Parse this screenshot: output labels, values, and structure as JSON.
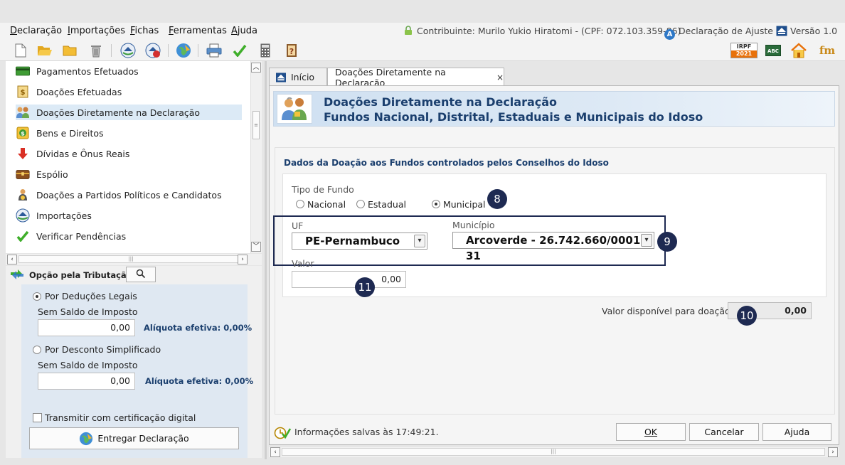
{
  "menu": [
    "Declaração",
    "Importações",
    "Fichas",
    "Ferramentas",
    "Ajuda"
  ],
  "header_info": {
    "taxpayer": "Contribuinte: Murilo Yukio Hiratomi - (CPF: 072.103.359-86)",
    "declaration_type": "Declaração de Ajuste",
    "version": "Versão 1.0"
  },
  "toolbar": {
    "icons": [
      "new-file-icon",
      "open-folder-icon",
      "folder-icon",
      "trash-icon",
      "receita-icon",
      "receita-refresh-icon",
      "globe-icon",
      "print-icon",
      "check-icon",
      "calculator-icon",
      "help-book-icon"
    ],
    "right_icons": [
      "irpf-2021-icon",
      "abc-icon",
      "home-icon",
      "fm-icon"
    ],
    "irpf_badge_top": "IRPF",
    "irpf_badge_year": "2021",
    "abc_badge": "ABC",
    "fm_badge": "fm"
  },
  "sidebar": {
    "items": [
      {
        "label": "Pagamentos Efetuados",
        "icon": "card-icon",
        "selected": false
      },
      {
        "label": "Doações Efetuadas",
        "icon": "doc-money-icon",
        "selected": false
      },
      {
        "label": "Doações Diretamente na Declaração",
        "icon": "people-icon",
        "selected": true
      },
      {
        "label": "Bens e Direitos",
        "icon": "money-bag-icon",
        "selected": false
      },
      {
        "label": "Dívidas e Ônus Reais",
        "icon": "down-arrow-icon",
        "selected": false
      },
      {
        "label": "Espólio",
        "icon": "chest-icon",
        "selected": false
      },
      {
        "label": "Doações a Partidos Políticos e Candidatos",
        "icon": "candidate-icon",
        "selected": false
      },
      {
        "label": "Importações",
        "icon": "import-icon",
        "selected": false
      },
      {
        "label": "Verificar Pendências",
        "icon": "check-icon",
        "selected": false
      }
    ]
  },
  "tributacao": {
    "title": "Opção pela Tributação:",
    "option1": {
      "label": "Por Deduções Legais",
      "selected": true,
      "sublabel": "Sem Saldo de Imposto",
      "value": "0,00",
      "aliquota": "Alíquota efetiva: 0,00%"
    },
    "option2": {
      "label": "Por Desconto Simplificado",
      "selected": false,
      "sublabel": "Sem Saldo de Imposto",
      "value": "0,00",
      "aliquota": "Alíquota efetiva: 0,00%"
    },
    "cert_label": "Transmitir com certificação digital",
    "deliver_button": "Entregar Declaração"
  },
  "tabs": [
    {
      "label": "Início",
      "active": false
    },
    {
      "label": "Doações Diretamente na Declaração",
      "active": true,
      "close": "×"
    }
  ],
  "banner": {
    "line1": "Doações Diretamente na Declaração",
    "line2": "Fundos Nacional, Distrital, Estaduais e Municipais do Idoso"
  },
  "form": {
    "section_title": "Dados da Doação aos Fundos controlados pelos Conselhos do Idoso",
    "tipo_label": "Tipo de Fundo",
    "tipo_options": [
      {
        "label": "Nacional",
        "selected": false
      },
      {
        "label": "Estadual",
        "selected": false
      },
      {
        "label": "Municipal",
        "selected": true
      }
    ],
    "uf_label": "UF",
    "uf_value": "PE-Pernambuco",
    "municipio_label": "Município",
    "municipio_value": "Arcoverde - 26.742.660/0001-31",
    "valor_label": "Valor",
    "valor_value": "0,00",
    "disponivel_label": "Valor disponível para doação:",
    "disponivel_value": "0,00"
  },
  "markers": [
    "8",
    "9",
    "10",
    "11"
  ],
  "footer": {
    "status": "Informações salvas às 17:49:21.",
    "ok": "OK",
    "cancel": "Cancelar",
    "help": "Ajuda"
  },
  "colors": {
    "marker": "#1e2a52",
    "banner_title": "#1b3f6e",
    "selection": "#dceaf6"
  }
}
